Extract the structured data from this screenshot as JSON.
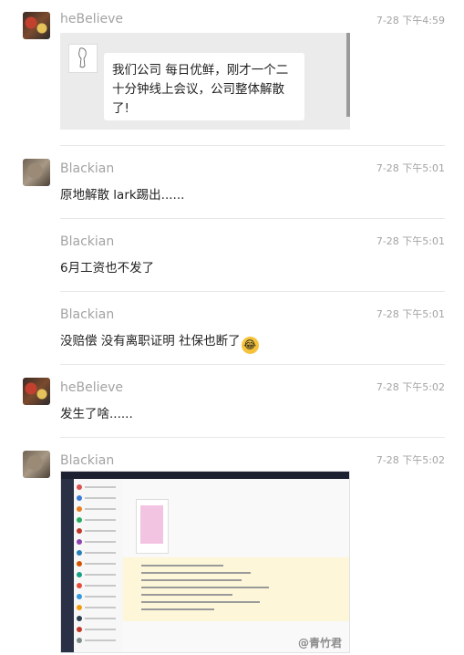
{
  "messages": [
    {
      "sender": "heBelieve",
      "time": "7-28 下午4:59",
      "quote": {
        "text_line1": "我们公司 每日优鲜，刚才一个二",
        "text_line2": "十分钟线上会议，公司整体解散",
        "text_line3": "了!"
      }
    },
    {
      "sender": "Blackian",
      "time": "7-28 下午5:01",
      "text": "原地解散 lark踢出......"
    },
    {
      "sender": "Blackian",
      "time": "7-28 下午5:01",
      "text": "6月工资也不发了"
    },
    {
      "sender": "Blackian",
      "time": "7-28 下午5:01",
      "text": "没赔偿 没有离职证明 社保也断了",
      "emoji": "😂"
    },
    {
      "sender": "heBelieve",
      "time": "7-28 下午5:02",
      "text": "发生了啥......"
    },
    {
      "sender": "Blackian",
      "time": "7-28 下午5:02",
      "image": {
        "watermark": "@青竹君"
      }
    }
  ],
  "colors": {
    "name": "#a3a3a3",
    "text": "#222222",
    "divider": "#e8e8e8",
    "quote_bg": "#ebebeb"
  }
}
